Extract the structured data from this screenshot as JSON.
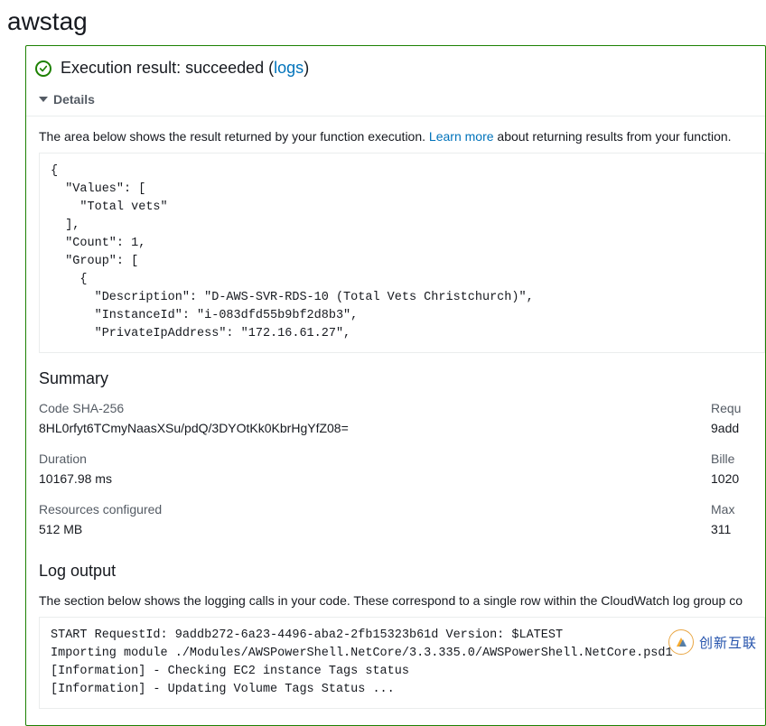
{
  "page_title": "awstag",
  "execution": {
    "label_pre": "Execution result: ",
    "status": "succeeded",
    "paren_open": " (",
    "logs_link": "logs",
    "paren_close": ")",
    "details_label": "Details"
  },
  "hint": {
    "pre": "The area below shows the result returned by your function execution. ",
    "link": "Learn more",
    "post": " about returning results from your function."
  },
  "result_json": "{\n  \"Values\": [\n    \"Total vets\"\n  ],\n  \"Count\": 1,\n  \"Group\": [\n    {\n      \"Description\": \"D-AWS-SVR-RDS-10 (Total Vets Christchurch)\",\n      \"InstanceId\": \"i-083dfd55b9bf2d8b3\",\n      \"PrivateIpAddress\": \"172.16.61.27\",",
  "summary": {
    "heading": "Summary",
    "left": [
      {
        "k": "Code SHA-256",
        "v": "8HL0rfyt6TCmyNaasXSu/pdQ/3DYOtKk0KbrHgYfZ08="
      },
      {
        "k": "Duration",
        "v": "10167.98 ms"
      },
      {
        "k": "Resources configured",
        "v": "512 MB"
      }
    ],
    "right": [
      {
        "k": "Requ",
        "v": "9add"
      },
      {
        "k": "Bille",
        "v": "1020"
      },
      {
        "k": "Max",
        "v": "311"
      }
    ]
  },
  "log": {
    "heading": "Log output",
    "hint": "The section below shows the logging calls in your code. These correspond to a single row within the CloudWatch log group co",
    "content": "START RequestId: 9addb272-6a23-4496-aba2-2fb15323b61d Version: $LATEST\nImporting module ./Modules/AWSPowerShell.NetCore/3.3.335.0/AWSPowerShell.NetCore.psd1\n[Information] - Checking EC2 instance Tags status\n[Information] - Updating Volume Tags Status ..."
  },
  "watermark": "创新互联"
}
